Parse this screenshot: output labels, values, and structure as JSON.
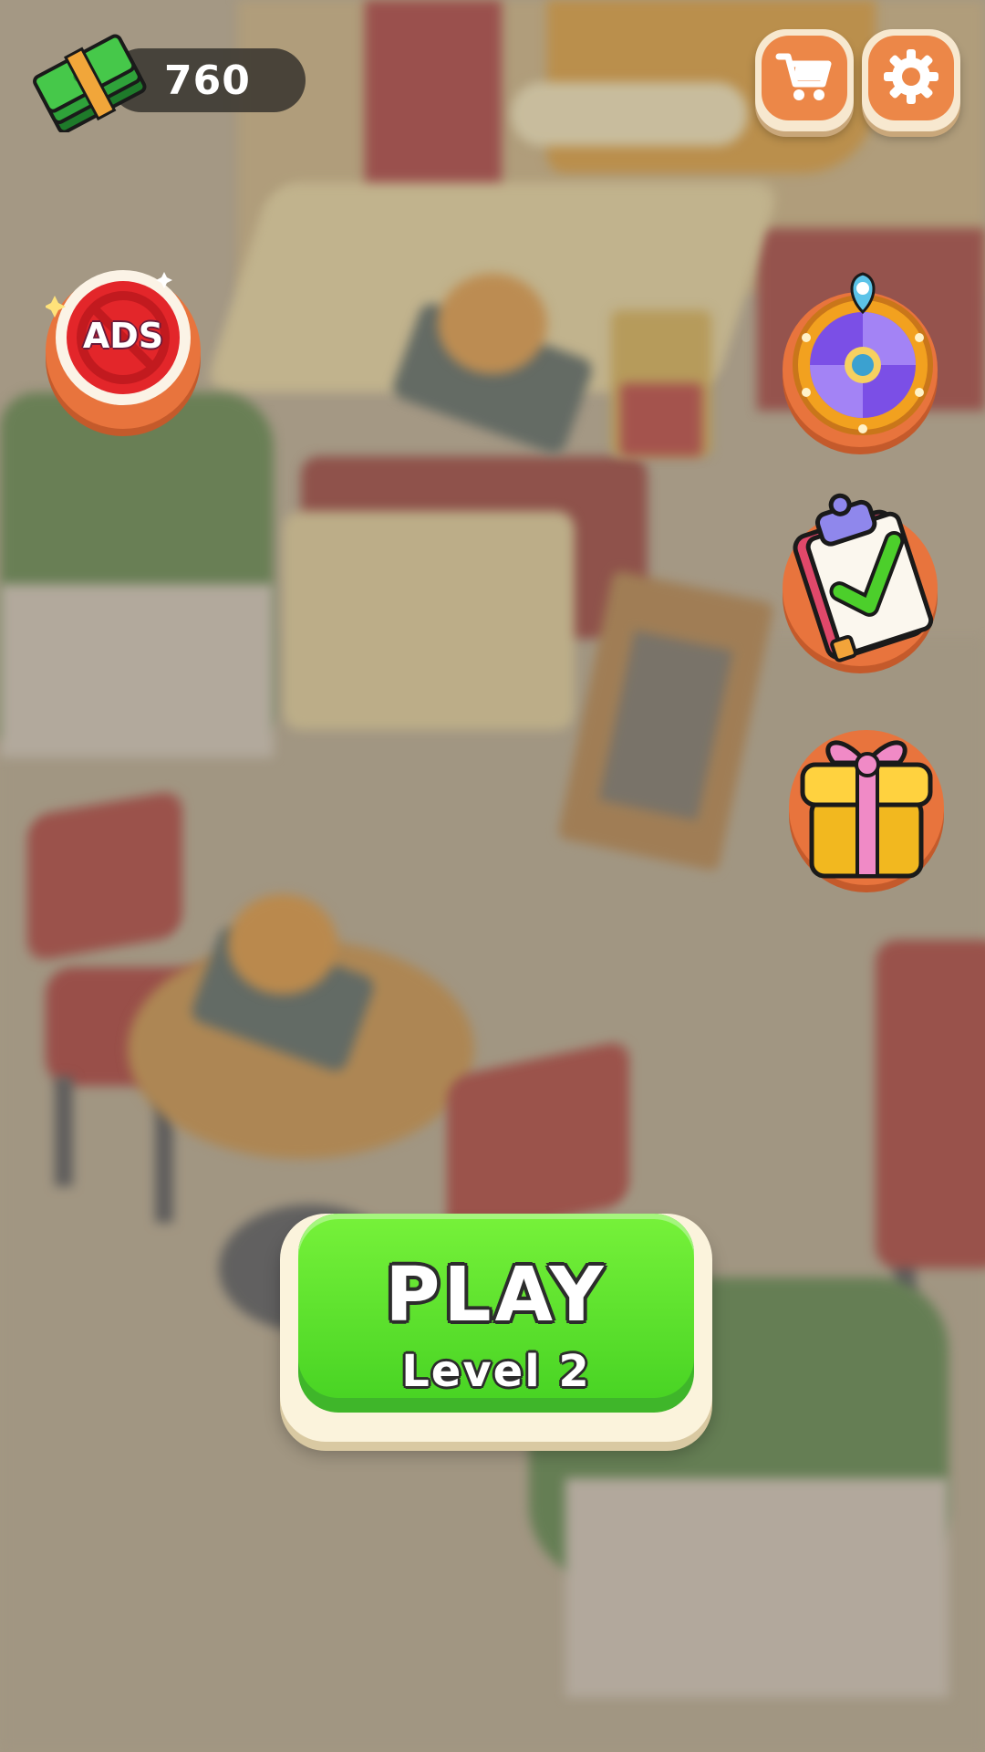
{
  "hud": {
    "cash_amount": "760",
    "cash_icon": "cash-stack-icon",
    "shop_icon": "shopping-cart-icon",
    "settings_icon": "gear-icon"
  },
  "side_buttons": {
    "ads_label": "ADS",
    "ads_icon": "no-ads-icon",
    "wheel_icon": "spin-wheel-icon",
    "tasks_icon": "clipboard-check-icon",
    "gift_icon": "gift-box-icon"
  },
  "play": {
    "label": "PLAY",
    "level_label": "Level 2"
  },
  "colors": {
    "play_green": "#5ee02c",
    "hud_orange": "#ec8748",
    "side_orange": "#e8743d",
    "ads_red": "#e3262a"
  }
}
